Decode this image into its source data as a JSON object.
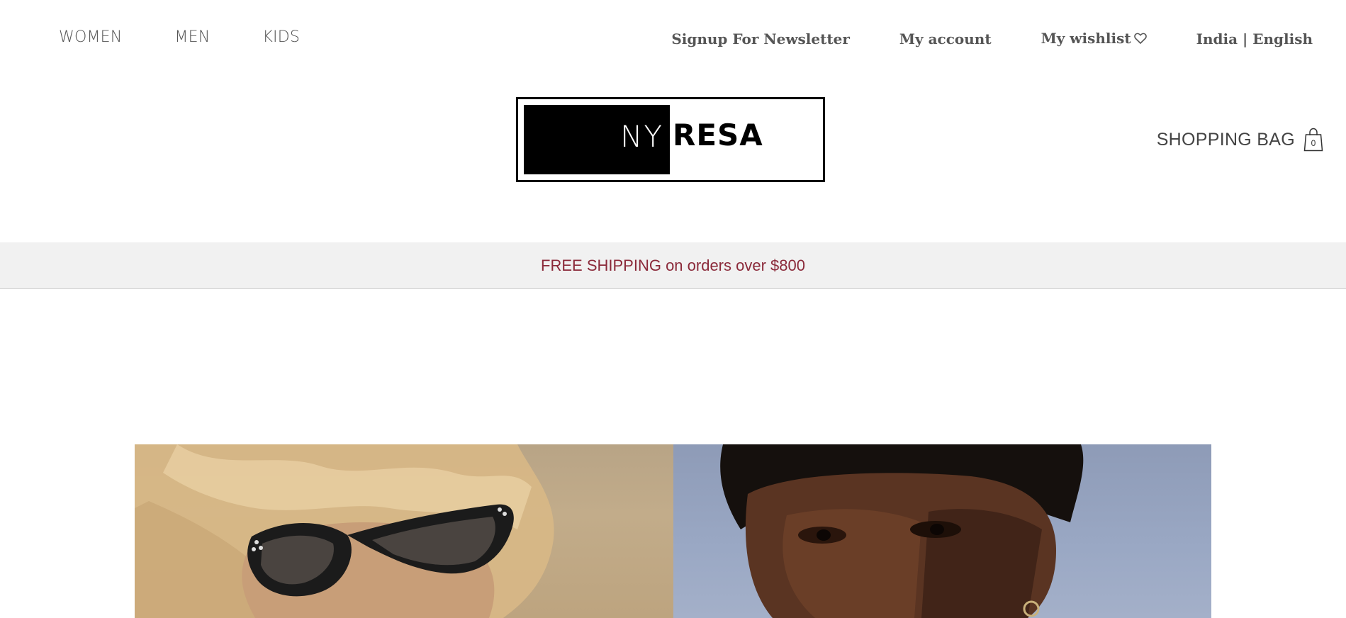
{
  "nav": {
    "categories": [
      {
        "label": "WOMEN"
      },
      {
        "label": "MEN"
      },
      {
        "label": "KIDS"
      }
    ],
    "utility": {
      "newsletter": "Signup For Newsletter",
      "account": "My account",
      "wishlist": "My wishlist",
      "locale": "India | English"
    }
  },
  "logo": {
    "part1": "NY",
    "part2": "RESA"
  },
  "bag": {
    "label": "SHOPPING BAG",
    "count": "0"
  },
  "promo": {
    "text": "FREE SHIPPING on orders over $800"
  },
  "icons": {
    "wishlist": "heart-icon",
    "bag": "shopping-bag-icon"
  },
  "colors": {
    "promo_text": "#8b2a3a",
    "promo_bg": "#f1f1f1",
    "nav_text": "#555555"
  }
}
